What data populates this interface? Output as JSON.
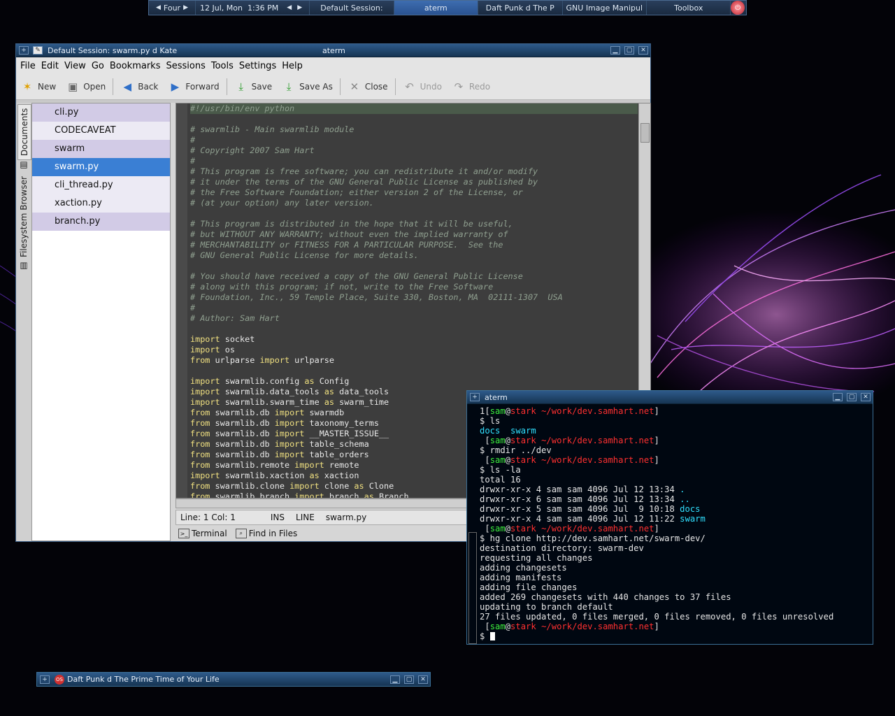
{
  "panel": {
    "desktop": "Four",
    "date": "12 Jul, Mon",
    "time": "1:36 PM",
    "tasks": [
      {
        "label": "Default Session:",
        "active": false
      },
      {
        "label": "aterm",
        "active": true
      },
      {
        "label": "Daft Punk d The P",
        "active": false
      },
      {
        "label": "GNU Image Manipul",
        "active": false
      }
    ],
    "toolbox": "Toolbox"
  },
  "kate": {
    "title": "Default Session: swarm.py d Kate",
    "title_right": "aterm",
    "menu": [
      "File",
      "Edit",
      "View",
      "Go",
      "Bookmarks",
      "Sessions",
      "Tools",
      "Settings",
      "Help"
    ],
    "toolbar": [
      {
        "label": "New",
        "icon": "new-icon",
        "glyph": "✶",
        "disabled": false
      },
      {
        "label": "Open",
        "icon": "open-icon",
        "glyph": "▣",
        "disabled": false
      },
      {
        "label": "Back",
        "icon": "back-icon",
        "glyph": "◀",
        "disabled": false
      },
      {
        "label": "Forward",
        "icon": "forward-icon",
        "glyph": "▶",
        "disabled": false
      },
      {
        "label": "Save",
        "icon": "save-icon",
        "glyph": "⤓",
        "disabled": false
      },
      {
        "label": "Save As",
        "icon": "save-as-icon",
        "glyph": "⤓",
        "disabled": false
      },
      {
        "label": "Close",
        "icon": "close-doc-icon",
        "glyph": "✕",
        "disabled": false
      },
      {
        "label": "Undo",
        "icon": "undo-icon",
        "glyph": "↶",
        "disabled": true
      },
      {
        "label": "Redo",
        "icon": "redo-icon",
        "glyph": "↷",
        "disabled": true
      }
    ],
    "side_tabs": {
      "documents": "Documents",
      "filesystem": "Filesystem Browser"
    },
    "documents": [
      {
        "name": "cli.py",
        "style": "a"
      },
      {
        "name": "CODECAVEAT",
        "style": "b"
      },
      {
        "name": "swarm",
        "style": "a"
      },
      {
        "name": "swarm.py",
        "style": "sel"
      },
      {
        "name": "cli_thread.py",
        "style": "b"
      },
      {
        "name": "xaction.py",
        "style": "a"
      },
      {
        "name": "branch.py",
        "style": "a"
      }
    ],
    "code": [
      "#!/usr/bin/env python",
      "",
      "# swarmlib - Main swarmlib module",
      "#",
      "# Copyright 2007 Sam Hart",
      "#",
      "# This program is free software; you can redistribute it and/or modify",
      "# it under the terms of the GNU General Public License as published by",
      "# the Free Software Foundation; either version 2 of the License, or",
      "# (at your option) any later version.",
      "",
      "# This program is distributed in the hope that it will be useful,",
      "# but WITHOUT ANY WARRANTY; without even the implied warranty of",
      "# MERCHANTABILITY or FITNESS FOR A PARTICULAR PURPOSE.  See the",
      "# GNU General Public License for more details.",
      "",
      "# You should have received a copy of the GNU General Public License",
      "# along with this program; if not, write to the Free Software",
      "# Foundation, Inc., 59 Temple Place, Suite 330, Boston, MA  02111-1307  USA",
      "#",
      "# Author: Sam Hart",
      "",
      "import socket",
      "import os",
      "from urlparse import urlparse",
      "",
      "import swarmlib.config as Config",
      "import swarmlib.data_tools as data_tools",
      "import swarmlib.swarm_time as swarm_time",
      "from swarmlib.db import swarmdb",
      "from swarmlib.db import taxonomy_terms",
      "from swarmlib.db import __MASTER_ISSUE__",
      "from swarmlib.db import table_schema",
      "from swarmlib.db import table_orders",
      "from swarmlib.remote import remote",
      "import swarmlib.xaction as xaction",
      "from swarmlib.clone import clone as Clone",
      "from swarmlib.branch import branch as Branch"
    ],
    "status": {
      "position": "Line: 1 Col: 1",
      "mode": "INS",
      "select_mode": "LINE",
      "file": "swarm.py"
    },
    "bottom_tabs": [
      "Terminal",
      "Find in Files"
    ]
  },
  "aterm": {
    "title": "aterm",
    "prompt": {
      "user": "sam",
      "host": "stark",
      "path": "~/work/dev.samhart.net"
    },
    "lines": [
      {
        "type": "prompt",
        "prefix": "1["
      },
      {
        "type": "cmd",
        "text": "$ ls"
      },
      {
        "type": "dirs",
        "items": [
          "docs",
          "swarm"
        ]
      },
      {
        "type": "prompt",
        "prefix": " ["
      },
      {
        "type": "cmd",
        "text": "$ rmdir ../dev"
      },
      {
        "type": "prompt",
        "prefix": " ["
      },
      {
        "type": "cmd",
        "text": "$ ls -la"
      },
      {
        "type": "out",
        "text": "total 16"
      },
      {
        "type": "ls",
        "text": "drwxr-xr-x 4 sam sam 4096 Jul 12 13:34 ",
        "name": "."
      },
      {
        "type": "ls",
        "text": "drwxr-xr-x 6 sam sam 4096 Jul 12 13:34 ",
        "name": ".."
      },
      {
        "type": "ls",
        "text": "drwxr-xr-x 5 sam sam 4096 Jul  9 10:18 ",
        "name": "docs"
      },
      {
        "type": "ls",
        "text": "drwxr-xr-x 4 sam sam 4096 Jul 12 11:22 ",
        "name": "swarm"
      },
      {
        "type": "prompt",
        "prefix": " ["
      },
      {
        "type": "cmd",
        "text": "$ hg clone http://dev.samhart.net/swarm-dev/"
      },
      {
        "type": "out",
        "text": "destination directory: swarm-dev"
      },
      {
        "type": "out",
        "text": "requesting all changes"
      },
      {
        "type": "out",
        "text": "adding changesets"
      },
      {
        "type": "out",
        "text": "adding manifests"
      },
      {
        "type": "out",
        "text": "adding file changes"
      },
      {
        "type": "out",
        "text": "added 269 changesets with 440 changes to 37 files"
      },
      {
        "type": "out",
        "text": "updating to branch default"
      },
      {
        "type": "out",
        "text": "27 files updated, 0 files merged, 0 files removed, 0 files unresolved"
      },
      {
        "type": "prompt",
        "prefix": " ["
      },
      {
        "type": "cursor",
        "text": "$ "
      }
    ]
  },
  "minimized": {
    "title": "Daft Punk d The Prime Time of Your Life",
    "icon_text": "OS"
  }
}
